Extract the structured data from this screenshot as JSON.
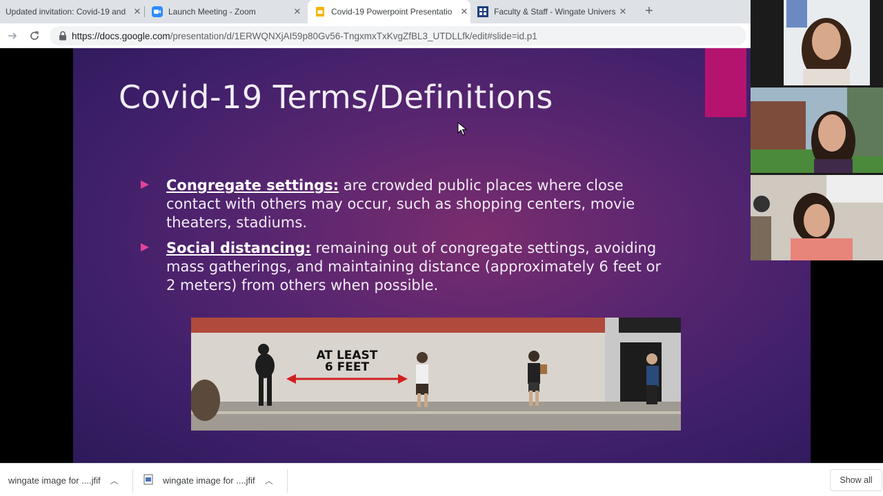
{
  "browser": {
    "tabs": [
      {
        "title": "Updated invitation: Covid-19 and",
        "icon": "gmail-icon"
      },
      {
        "title": "Launch Meeting - Zoom",
        "icon": "zoom-icon"
      },
      {
        "title": "Covid-19 Powerpoint Presentatio",
        "icon": "google-slides-icon"
      },
      {
        "title": "Faculty & Staff - Wingate Univers",
        "icon": "wingate-icon"
      }
    ],
    "new_tab_label": "+",
    "close_glyph": "✕",
    "url_host": "https://docs.google.com",
    "url_path": "/presentation/d/1ERWQNXjAI59p80Gv56-TngxmxTxKvgZfBL3_UTDLLfk/edit#slide=id.p1"
  },
  "slide": {
    "title": "Covid-19 Terms/Definitions",
    "bullets": [
      {
        "term": "Congregate settings:",
        "text": " are crowded public places where close contact with others may occur, such as shopping centers, movie theaters, stadiums."
      },
      {
        "term": "Social distancing:",
        "text": " remaining out of congregate settings, avoiding mass gatherings, and maintaining distance (approximately 6 feet or 2 meters) from others when possible."
      }
    ],
    "image": {
      "sign_line1": "AT LEAST",
      "sign_line2": "6 FEET"
    }
  },
  "downloads": {
    "items": [
      {
        "name": "wingate image for ....jfif"
      },
      {
        "name": "wingate image for ....jfif"
      }
    ],
    "show_all": "Show all"
  },
  "colors": {
    "accent": "#b5146e",
    "bullet_arrow": "#e0449a"
  }
}
